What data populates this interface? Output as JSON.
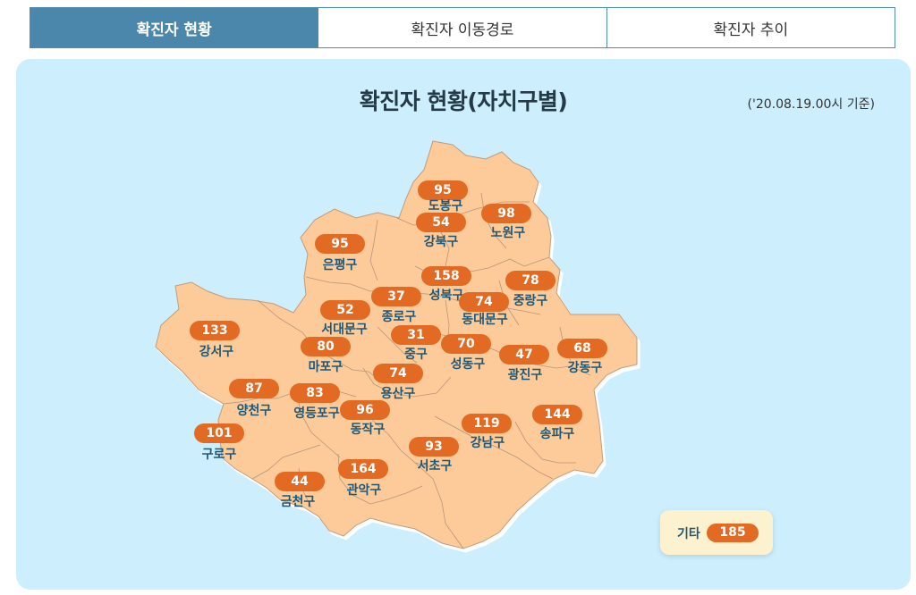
{
  "tabs": [
    {
      "label": "확진자 현황",
      "active": true
    },
    {
      "label": "확진자 이동경로",
      "active": false
    },
    {
      "label": "확진자 추이",
      "active": false
    }
  ],
  "title": "확진자 현황(자치구별)",
  "date": "('20.08.19.00시 기준)",
  "colors": {
    "map_fill": "#fdcb9a",
    "badge": "#e26a22",
    "panel": "#cdeefd",
    "tab_active": "#4a87ab"
  },
  "districts": [
    {
      "name": "도봉구",
      "count": "95"
    },
    {
      "name": "노원구",
      "count": "98"
    },
    {
      "name": "강북구",
      "count": "54"
    },
    {
      "name": "은평구",
      "count": "95"
    },
    {
      "name": "성북구",
      "count": "158"
    },
    {
      "name": "중랑구",
      "count": "78"
    },
    {
      "name": "종로구",
      "count": "37"
    },
    {
      "name": "동대문구",
      "count": "74"
    },
    {
      "name": "서대문구",
      "count": "52"
    },
    {
      "name": "강서구",
      "count": "133"
    },
    {
      "name": "중구",
      "count": "31"
    },
    {
      "name": "마포구",
      "count": "80"
    },
    {
      "name": "성동구",
      "count": "70"
    },
    {
      "name": "광진구",
      "count": "47"
    },
    {
      "name": "강동구",
      "count": "68"
    },
    {
      "name": "용산구",
      "count": "74"
    },
    {
      "name": "양천구",
      "count": "87"
    },
    {
      "name": "영등포구",
      "count": "83"
    },
    {
      "name": "동작구",
      "count": "96"
    },
    {
      "name": "송파구",
      "count": "144"
    },
    {
      "name": "강남구",
      "count": "119"
    },
    {
      "name": "구로구",
      "count": "101"
    },
    {
      "name": "서초구",
      "count": "93"
    },
    {
      "name": "관악구",
      "count": "164"
    },
    {
      "name": "금천구",
      "count": "44"
    }
  ],
  "other": {
    "label": "기타",
    "count": "185"
  }
}
